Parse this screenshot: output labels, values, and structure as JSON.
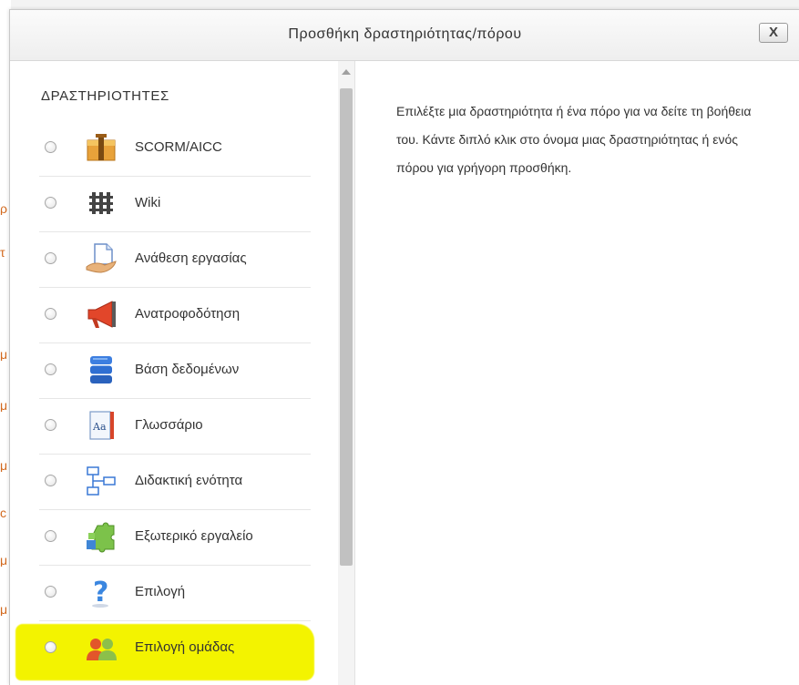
{
  "dialog": {
    "title": "Προσθήκη δραστηριότητας/πόρου",
    "close_label": "X"
  },
  "activities": {
    "heading": "ΔΡΑΣΤΗΡΙΟΤΗΤΕΣ",
    "items": [
      {
        "label": "SCORM/AICC",
        "icon": "scorm-package-icon",
        "selected": false
      },
      {
        "label": "Wiki",
        "icon": "wiki-icon",
        "selected": false
      },
      {
        "label": "Ανάθεση εργασίας",
        "icon": "assignment-icon",
        "selected": false
      },
      {
        "label": "Ανατροφοδότηση",
        "icon": "feedback-megaphone-icon",
        "selected": false
      },
      {
        "label": "Βάση δεδομένων",
        "icon": "database-icon",
        "selected": false
      },
      {
        "label": "Γλωσσάριο",
        "icon": "glossary-icon",
        "selected": false
      },
      {
        "label": "Διδακτική ενότητα",
        "icon": "lesson-icon",
        "selected": false
      },
      {
        "label": "Εξωτερικό εργαλείο",
        "icon": "external-tool-puzzle-icon",
        "selected": false
      },
      {
        "label": "Επιλογή",
        "icon": "choice-question-icon",
        "selected": false
      },
      {
        "label": "Επιλογή ομάδας",
        "icon": "group-choice-icon",
        "selected": false,
        "highlighted": true
      }
    ]
  },
  "help": {
    "text": "Επιλέξτε μια δραστηριότητα ή ένα πόρο για να δείτε τη βοήθεια του. Κάντε διπλό κλικ στο όνομα μιας δραστηριότητας ή ενός πόρου για γρήγορη προσθήκη."
  },
  "backdrop": {
    "fragments": [
      "ρ",
      "τ",
      "μ",
      "μ",
      "μ",
      "c",
      "μ",
      "μ"
    ]
  },
  "colors": {
    "highlight": "#f3f300",
    "text": "#333333",
    "backdrop_fragment": "#d2691e"
  }
}
